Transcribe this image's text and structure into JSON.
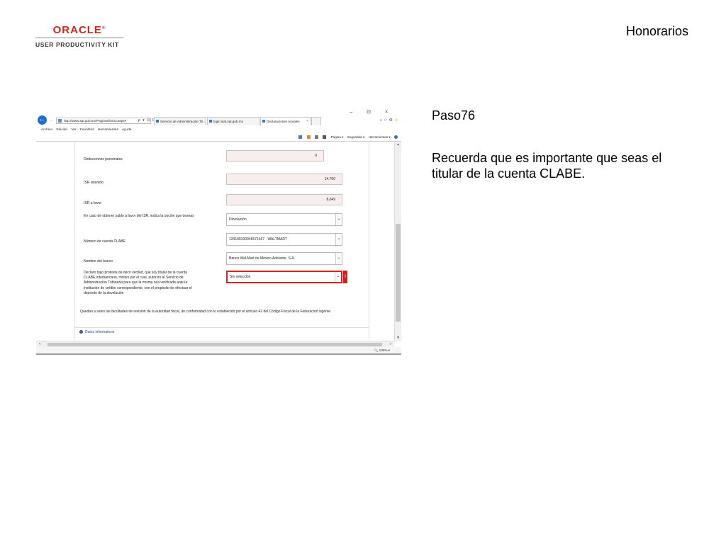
{
  "slide": {
    "logo_text": "ORACLE",
    "logo_mark": "®",
    "logo_subtitle": "USER PRODUCTIVITY KIT",
    "title": "Honorarios",
    "step_label": "Paso76",
    "step_text": "Recuerda que es importante que seas el titular de la cuenta CLABE."
  },
  "browser": {
    "address": "http://www.sat.gob.mx/Paginas/inicio.aspx#",
    "address_tools": "ρ ▾ ⊡ C",
    "tabs": [
      {
        "label": "Servicio de Administración Tri..."
      },
      {
        "label": "login.siat.sat.gob.mx"
      },
      {
        "label": "Declaraciones Anuales"
      }
    ],
    "active_tab_close": "×",
    "window_controls": "–  ⊡  ×",
    "menu": [
      "Archivo",
      "Edición",
      "Ver",
      "Favoritos",
      "Herramientas",
      "Ayuda"
    ],
    "commands": [
      "Página ▾",
      "Seguridad ▾",
      "Herramientas ▾"
    ],
    "zoom": "100%",
    "icons": {
      "back": "back-arrow-icon",
      "home": "home-icon",
      "star": "star-icon",
      "gear": "gear-icon",
      "smiley": "smiley-icon"
    }
  },
  "form": {
    "deducciones_label": "Deducciones personales",
    "deducciones_value": "0",
    "isr_retenido_label": "ISR retenido",
    "isr_retenido_value": "14,700",
    "isr_favor_label": "ISR a favor",
    "isr_favor_value": "8,049",
    "saldo_label": "En caso de obtener saldo a favor del ISR, indica la opción que deseas",
    "saldo_value": "Devolución",
    "clabe_label": "Número de cuenta CLABE",
    "clabe_value": "134180100046571467 - WALTMART",
    "banco_label": "Nombre del banco",
    "banco_value": "Banco Wal-Mart de México Adelante, S.A.",
    "protesta_label": "Declaro bajo protesta de decir verdad, que soy titular de la cuenta CLABE interbancaria, motivo por el cual, autorizo al Servicio de Administración Tributaria para que la misma sea verificada ante la institución de crédito correspondiente, con el propósito de efectuar el depósito de la devolución",
    "protesta_value": "Sin selección",
    "error_mark": "!",
    "notice": "Quedan a salvo las facultades de revisión de la autoridad fiscal, de conformidad con lo establecido por el artículo 42 del Código Fiscal de la Federación vigente.",
    "datos_link": "Datos informativos"
  },
  "colors": {
    "oracle_red": "#d2261b",
    "highlight_red": "#e02020",
    "ie_blue": "#1e6fc8"
  }
}
